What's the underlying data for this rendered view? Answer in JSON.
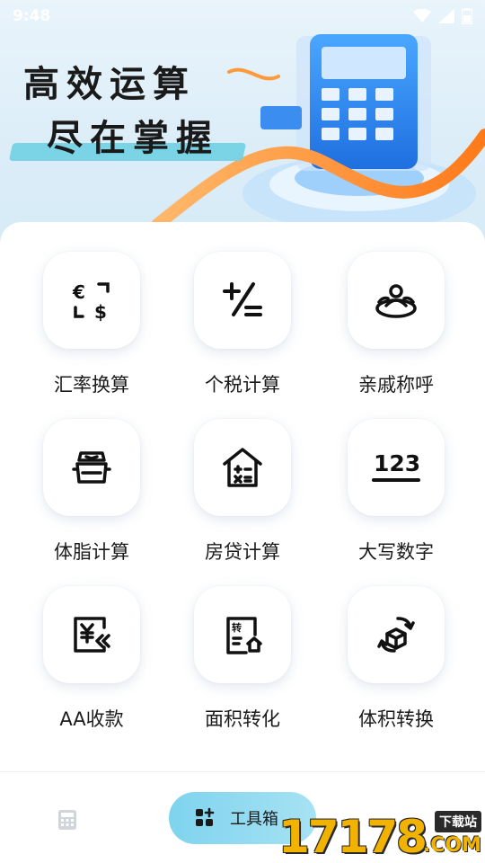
{
  "status_bar": {
    "time": "9:48"
  },
  "banner": {
    "slogan_line1": "高效运算",
    "slogan_line2": "尽在掌握"
  },
  "tools": [
    {
      "label": "汇率换算",
      "icon": "currency-exchange-icon"
    },
    {
      "label": "个税计算",
      "icon": "plus-minus-icon"
    },
    {
      "label": "亲戚称呼",
      "icon": "relatives-icon"
    },
    {
      "label": "体脂计算",
      "icon": "body-fat-scale-icon"
    },
    {
      "label": "房贷计算",
      "icon": "house-calculator-icon"
    },
    {
      "label": "大写数字",
      "icon": "number-123-icon"
    },
    {
      "label": "AA收款",
      "icon": "yuan-split-icon"
    },
    {
      "label": "面积转化",
      "icon": "area-convert-icon"
    },
    {
      "label": "体积转换",
      "icon": "volume-convert-icon"
    }
  ],
  "bottom_nav": {
    "calculator_icon": "calculator-icon",
    "toolbox_label": "工具箱"
  },
  "watermark": {
    "digits": "17178",
    "badge": "下载站",
    "domain": ".COM"
  },
  "colors": {
    "accent": "#7fd3ee",
    "banner_bg": "#dcedf8",
    "watermark": "#f2b300"
  }
}
